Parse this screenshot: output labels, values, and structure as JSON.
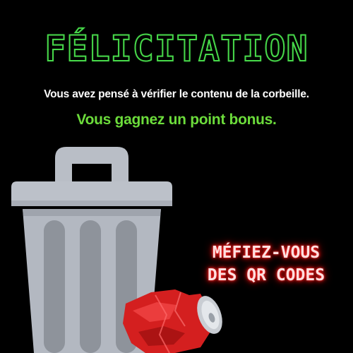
{
  "headline": "FÉLICITATION",
  "message": "Vous avez pensé à vérifier le contenu de la corbeille.",
  "bonus": "Vous gagnez un point bonus.",
  "warning": {
    "line1": "MÉFIEZ-VOUS",
    "line2": "DES QR CODES"
  },
  "colors": {
    "background": "#000000",
    "headline": "#47d94a",
    "bonus": "#6cdc3b",
    "warning_glow": "#ff2a2a",
    "bin": "#b9bec6",
    "can": "#d41f1f"
  },
  "icons": [
    "trash-bin-icon",
    "crushed-can-icon"
  ]
}
